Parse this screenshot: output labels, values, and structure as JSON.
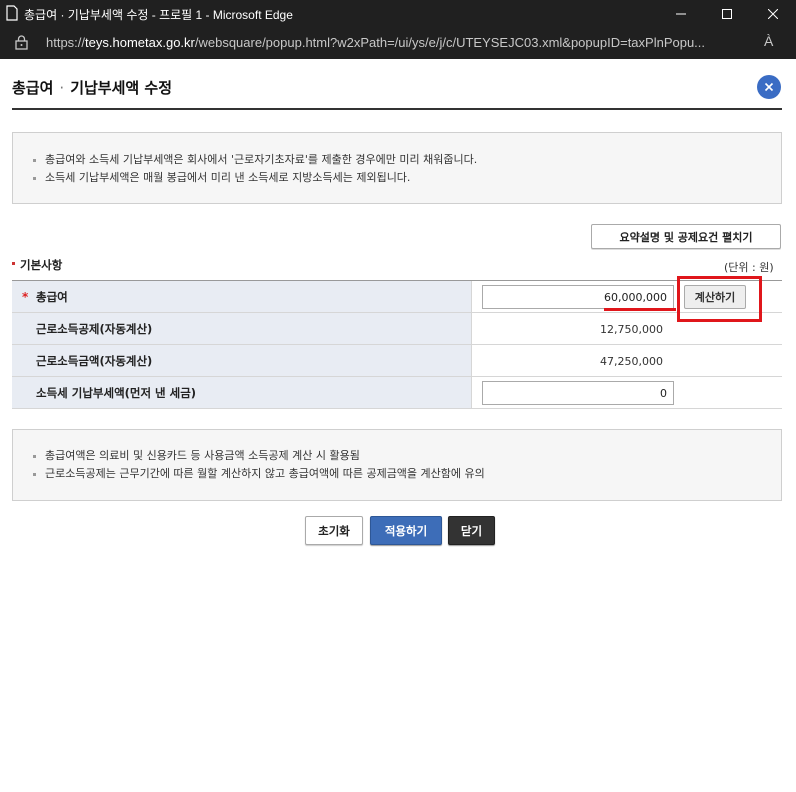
{
  "window": {
    "title": "총급여 · 기납부세액 수정 - 프로필 1 - Microsoft Edge",
    "url_scheme": "https://",
    "url_host": "teys.hometax.go.kr",
    "url_path": "/websquare/popup.html?w2xPath=/ui/ys/e/j/c/UTEYSEJC03.xml&popupID=taxPlnPopu...",
    "read_aloud": "À"
  },
  "popup": {
    "title_part1": "총급여",
    "title_sep": "·",
    "title_part2": "기납부세액 수정"
  },
  "notice_top": [
    "총급여와 소득세 기납부세액은 회사에서 '근로자기초자료'를 제출한 경우에만 미리 채워줍니다.",
    "소득세 기납부세액은 매월 봉급에서 미리 낸 소득세로 지방소득세는 제외됩니다."
  ],
  "summary_button": "요약설명 및 공제요건 펼치기",
  "section": {
    "title": "기본사항",
    "unit": "(단위 : 원)"
  },
  "rows": {
    "gross_pay": {
      "label": "총급여",
      "required_mark": "*",
      "value": "60,000,000",
      "calc_button": "계산하기"
    },
    "earned_income_deduction": {
      "label": "근로소득공제(자동계산)",
      "value": "12,750,000"
    },
    "earned_income_amount": {
      "label": "근로소득금액(자동계산)",
      "value": "47,250,000"
    },
    "prepaid_tax": {
      "label": "소득세 기납부세액(먼저 낸 세금)",
      "value": "0"
    }
  },
  "notice_bottom": [
    "총급여액은 의료비 및 신용카드 등 사용금액 소득공제 계산 시 활용됨",
    "근로소득공제는 근무기간에 따른 월할 계산하지 않고 총급여액에 따른 공제금액을 계산함에 유의"
  ],
  "buttons": {
    "reset": "초기화",
    "apply": "적용하기",
    "close": "닫기"
  },
  "colors": {
    "titlebar": "#202020",
    "accent_blue": "#3d6db8",
    "highlight_red": "#e0161b",
    "header_cell": "#e8ecf3"
  }
}
